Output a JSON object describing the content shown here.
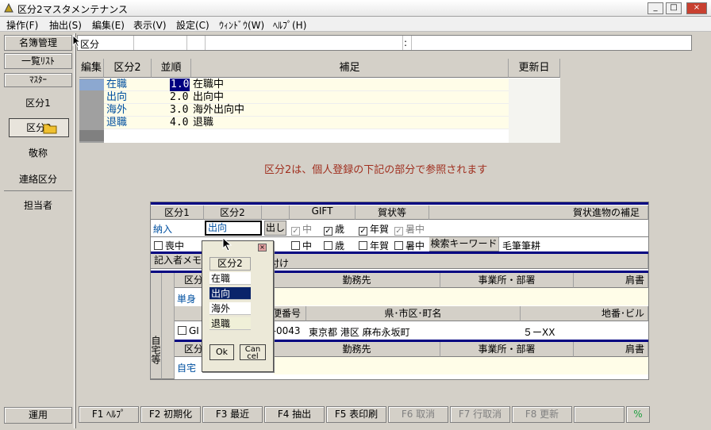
{
  "window": {
    "title": "区分2マスタメンテナンス",
    "min": "_",
    "max": "□",
    "close": "×"
  },
  "menu": [
    "操作(F)",
    "抽出(S)",
    "編集(E)",
    "表示(V)",
    "設定(C)",
    "ｳｨﾝﾄﾞｳ(W)",
    "ﾍﾙﾌﾟ(H)"
  ],
  "sidebar": {
    "names": "名簿管理",
    "list": "一覧ﾘｽﾄ",
    "master": "ﾏｽﾀｰ",
    "items": [
      "区分1",
      "区分2",
      "敬称",
      "連絡区分",
      "担当者"
    ],
    "run": "運用"
  },
  "filter": {
    "label": "区分",
    "sep": ":"
  },
  "grid": {
    "headers": [
      "編集",
      "区分2",
      "並順",
      "補足",
      "更新日"
    ],
    "rows": [
      {
        "kubun": "在職",
        "order": "1.0",
        "note": "在職中"
      },
      {
        "kubun": "出向",
        "order": "2.0",
        "note": "出向中"
      },
      {
        "kubun": "海外",
        "order": "3.0",
        "note": "海外出向中"
      },
      {
        "kubun": "退職",
        "order": "4.0",
        "note": "退職"
      }
    ]
  },
  "message": "区分2は、個人登録の下記の部分で参照されます",
  "detail": {
    "h1": "区分1",
    "h2": "区分2",
    "gift": "GIFT",
    "nenga_h": "賀状等",
    "hosoku": "賀状進物の補足",
    "nyu": "納入",
    "kubun2_val": "出向",
    "dashi": "出し",
    "chu": "中",
    "sai": "歳",
    "nenga": "年賀",
    "shochu": "暑中",
    "mochu": "喪中",
    "keyword": "検索キーワード",
    "keyword_val": "毛筆筆耕",
    "memo": "記入者メモ",
    "sec_kubun": "区分",
    "kinmu": "勤務先",
    "jigyo": "事業所・部署",
    "katagaki": "肩書",
    "tanshin": "単身",
    "yubin": "便番号",
    "ken": "県･市区･町名",
    "chiban": "地番･ビル",
    "zip": "5-0043",
    "addr": "東京都 港区 麻布永坂町",
    "bldg": "５ーXX",
    "gi": "GI",
    "zuke": "付け",
    "jitaku": "自宅",
    "side": "自宅等",
    "kubun_b": "区分"
  },
  "popup": {
    "title": "区分2",
    "items": [
      "在職",
      "出向",
      "海外",
      "退職"
    ],
    "ok": "Ok",
    "cancel": "Can cel"
  },
  "footer": [
    "F1 ﾍﾙﾌﾟ",
    "F2 初期化",
    "F3 最近",
    "F4 抽出",
    "F5 表印刷",
    "F6 取消",
    "F7 行取消",
    "F8 更新"
  ]
}
